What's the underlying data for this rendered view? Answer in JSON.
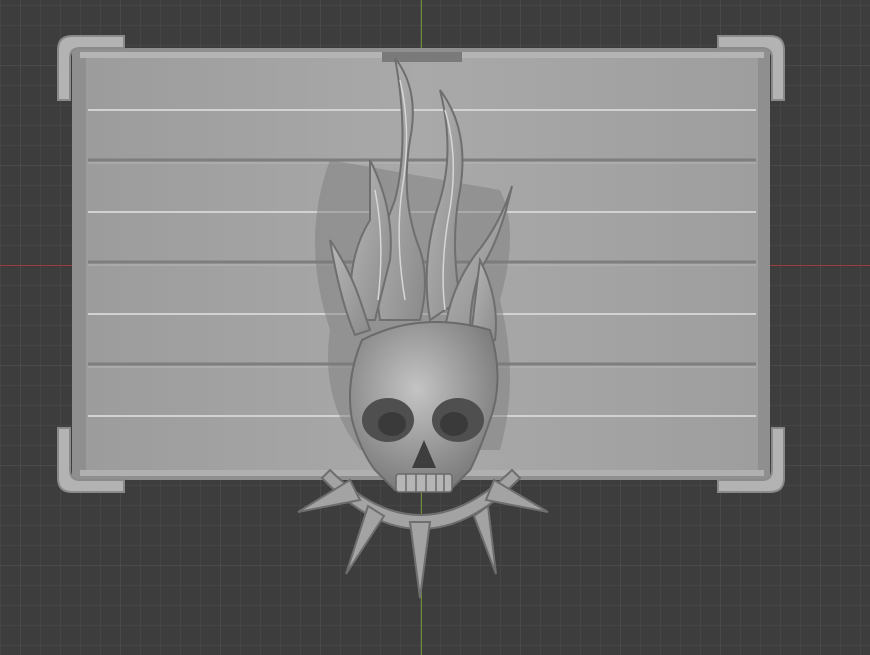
{
  "viewport": {
    "view": "top-orthographic",
    "background_color": "#3d3d3d",
    "grid_color": "#454545",
    "x_axis_color": "#9a3d3d",
    "y_axis_color": "#6f8f2e"
  },
  "model": {
    "parts": [
      "base-plate",
      "corner-brackets",
      "flame-skull",
      "spiked-ring"
    ],
    "material_color": "#a6a6a6"
  }
}
